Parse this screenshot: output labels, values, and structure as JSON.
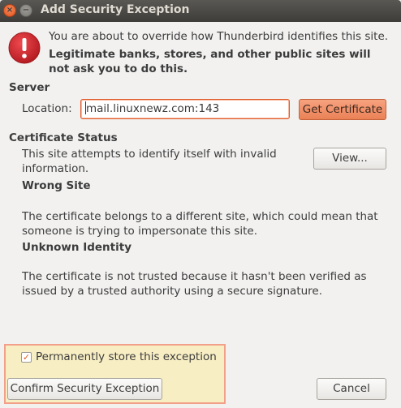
{
  "window": {
    "title": "Add Security Exception",
    "close_glyph": "×",
    "minimize_glyph": "−"
  },
  "warning": {
    "icon": "exclamation-warning-icon",
    "line1": "You are about to override how Thunderbird identifies this site.",
    "line2": "Legitimate banks, stores, and other public sites will not ask you to do this."
  },
  "server": {
    "heading": "Server",
    "location_label": "Location:",
    "location_value": "mail.linuxnewz.com:143",
    "get_certificate_label": "Get Certificate"
  },
  "certificate_status": {
    "heading": "Certificate Status",
    "description": "This site attempts to identify itself with invalid information.",
    "view_button_label": "View...",
    "wrong_site_heading": "Wrong Site",
    "wrong_site_text": "The certificate belongs to a different site, which could mean that someone is trying to impersonate this site.",
    "unknown_identity_heading": "Unknown Identity",
    "unknown_identity_text": "The certificate is not trusted because it hasn't been verified as issued by a trusted authority using a secure signature."
  },
  "footer": {
    "permanent_checkbox_label": "Permanently store this exception",
    "permanent_checked": true,
    "confirm_button_label": "Confirm Security Exception",
    "cancel_button_label": "Cancel"
  },
  "colors": {
    "accent_orange": "#e95420",
    "highlight_box": "#f8eec4",
    "warning_red": "#d9272e"
  }
}
